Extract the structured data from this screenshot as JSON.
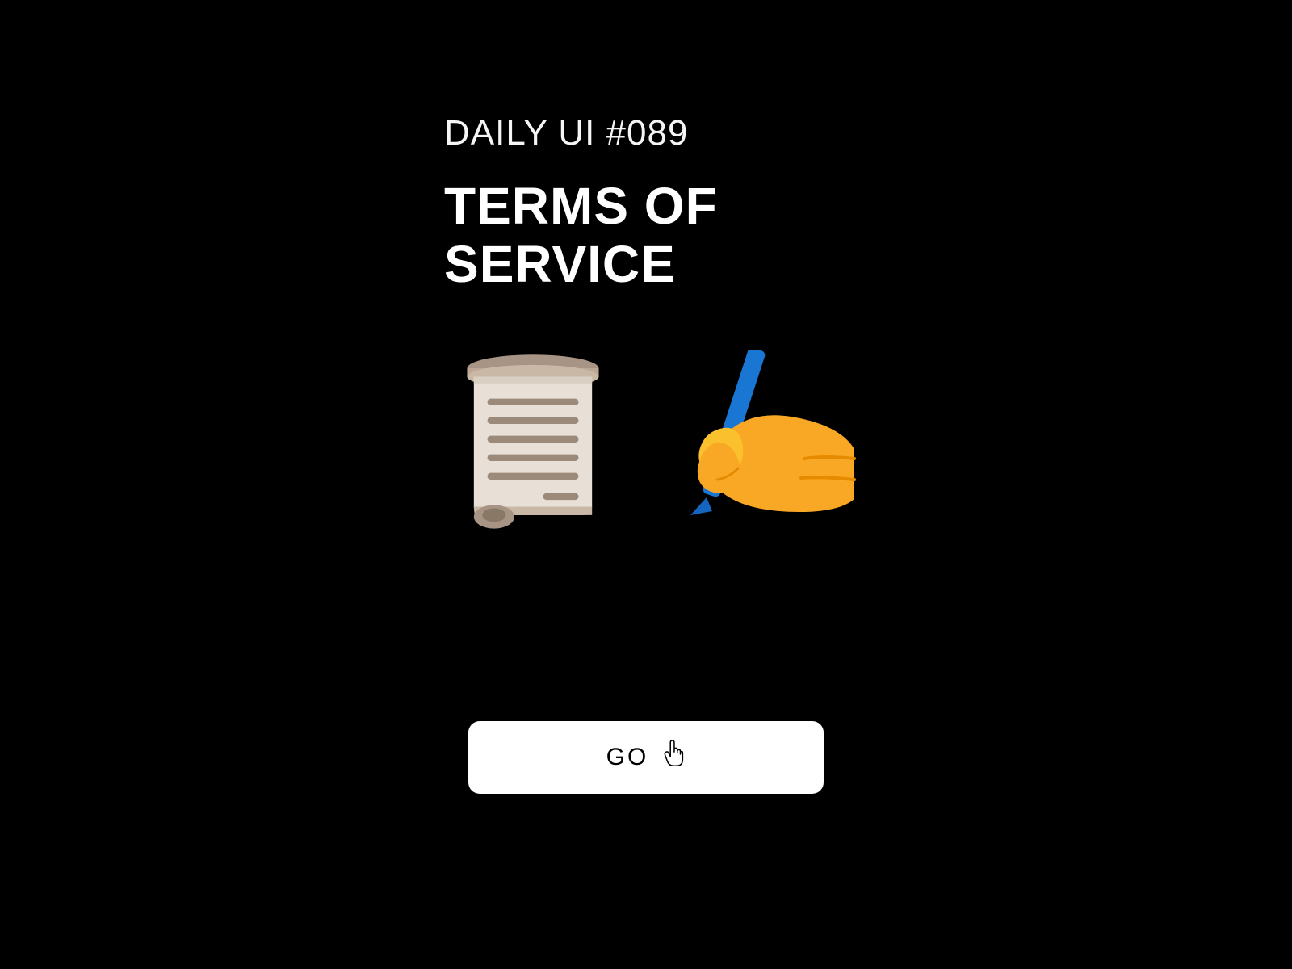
{
  "header": {
    "subtitle": "DAILY UI #089",
    "title": "TERMS OF SERVICE"
  },
  "icons": {
    "scroll": "scroll-icon",
    "writing_hand": "writing-hand-icon"
  },
  "button": {
    "label": "GO",
    "cursor_icon": "hand-cursor-icon"
  },
  "colors": {
    "background": "#000000",
    "text": "#ffffff",
    "button_bg": "#ffffff",
    "button_text": "#000000",
    "scroll_paper": "#e8dfd6",
    "scroll_roll": "#a89484",
    "scroll_lines": "#9b8a7a",
    "hand_color": "#f9a825",
    "pen_color": "#1976d2"
  }
}
